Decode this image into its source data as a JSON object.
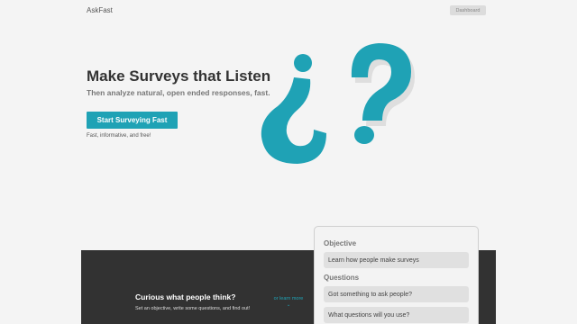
{
  "nav": {
    "brand": "AskFast",
    "dashboard_label": "Dashboard"
  },
  "hero": {
    "title": "Make Surveys that Listen",
    "subtitle": "Then analyze natural, open ended responses, fast.",
    "cta_label": "Start Surveying Fast",
    "tagline": "Fast, informative, and free!",
    "art": {
      "accent_color": "#1fa2b5",
      "shadow_color": "#d6d6d6"
    }
  },
  "band": {
    "title": "Curious what people think?",
    "text": "Set an objective, write some questions, and find out!",
    "learn_more_line1": "or learn more",
    "learn_more_arrow": "⌄"
  },
  "form": {
    "objective_label": "Objective",
    "objective_value": "Learn how people make surveys",
    "questions_label": "Questions",
    "questions": [
      "Got something to ask people?",
      "What questions will you use?"
    ]
  },
  "colors": {
    "accent": "#1fa2b5",
    "band_bg": "#323232",
    "page_bg": "#f4f4f4"
  }
}
